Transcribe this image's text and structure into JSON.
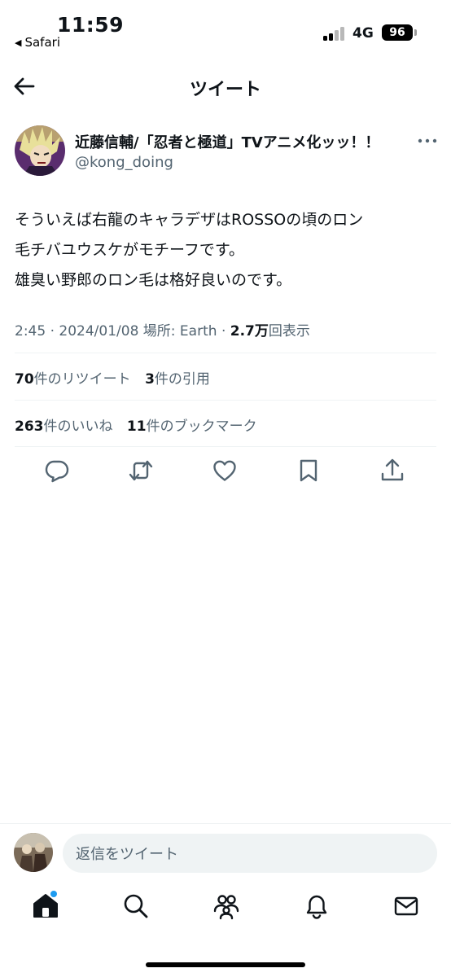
{
  "status_bar": {
    "time": "11:59",
    "back_app": "Safari",
    "network": "4G",
    "battery": "96"
  },
  "header": {
    "title": "ツイート"
  },
  "author": {
    "name": "近藤信輔/「忍者と極道」TVアニメ化ッッ！！",
    "handle": "@kong_doing"
  },
  "tweet": {
    "lines": [
      "そういえば右龍のキャラデザはROSSOの頃のロン",
      "毛チバユウスケがモチーフです。",
      "雄臭い野郎のロン毛は格好良いのです。"
    ],
    "time": "2:45",
    "date": "2024/01/08",
    "location": "場所: Earth",
    "views_count": "2.7万",
    "views_label": "回表示"
  },
  "stats": {
    "retweets_count": "70",
    "retweets_label": "件のリツイート",
    "quotes_count": "3",
    "quotes_label": "件の引用",
    "likes_count": "263",
    "likes_label": "件のいいね",
    "bookmarks_count": "11",
    "bookmarks_label": "件のブックマーク"
  },
  "reply": {
    "placeholder": "返信をツイート"
  },
  "colors": {
    "text": "#0f1419",
    "secondary": "#536471",
    "accent": "#1d9bf0",
    "divider": "#eff3f4"
  },
  "icons": {
    "actions": [
      "reply-icon",
      "retweet-icon",
      "like-icon",
      "bookmark-icon",
      "share-icon"
    ],
    "nav": [
      "home-icon",
      "search-icon",
      "communities-icon",
      "notifications-icon",
      "messages-icon"
    ]
  }
}
